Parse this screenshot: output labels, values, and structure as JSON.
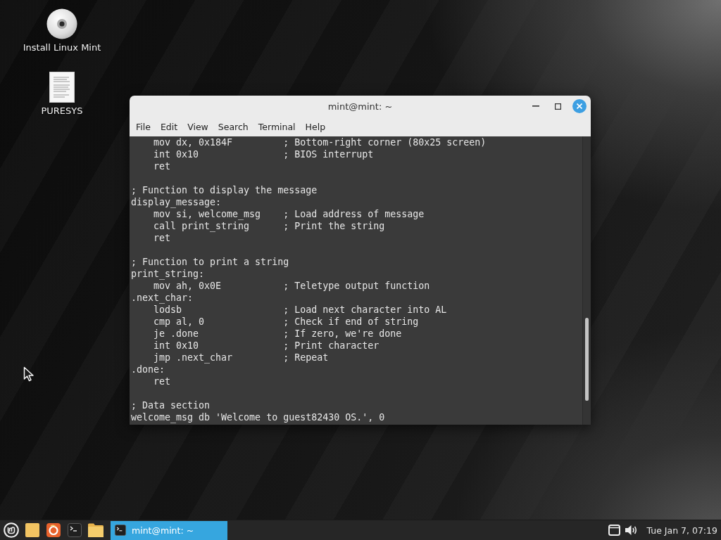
{
  "desktop": {
    "icons": [
      {
        "kind": "disc",
        "label": "Install Linux Mint"
      },
      {
        "kind": "document",
        "label": "PURESYS"
      }
    ]
  },
  "window": {
    "title": "mint@mint: ~",
    "menu": [
      "File",
      "Edit",
      "View",
      "Search",
      "Terminal",
      "Help"
    ],
    "terminal": {
      "blocks": [
        [
          "    mov dx, 0x184F         ; Bottom-right corner (80x25 screen)",
          "    int 0x10               ; BIOS interrupt",
          "    ret"
        ],
        [
          "; Function to display the message",
          "display_message:",
          "    mov si, welcome_msg    ; Load address of message",
          "    call print_string      ; Print the string",
          "    ret"
        ],
        [
          "; Function to print a string",
          "print_string:",
          "    mov ah, 0x0E           ; Teletype output function",
          ".next_char:",
          "    lodsb                  ; Load next character into AL",
          "    cmp al, 0              ; Check if end of string",
          "    je .done               ; If zero, we're done",
          "    int 0x10               ; Print character",
          "    jmp .next_char         ; Repeat",
          ".done:",
          "    ret"
        ],
        [
          "; Data section",
          "welcome_msg db 'Welcome to guest82430 OS.', 0"
        ]
      ]
    }
  },
  "taskbar": {
    "launchers": [
      {
        "kind": "menu"
      },
      {
        "kind": "tile"
      },
      {
        "kind": "browser"
      },
      {
        "kind": "terminal"
      },
      {
        "kind": "folder"
      }
    ],
    "windows": [
      {
        "title": "mint@mint: ~",
        "selected": true
      }
    ],
    "tray": [
      {
        "kind": "window"
      },
      {
        "kind": "volume"
      }
    ],
    "clock": "Tue Jan 7, 07:19"
  }
}
